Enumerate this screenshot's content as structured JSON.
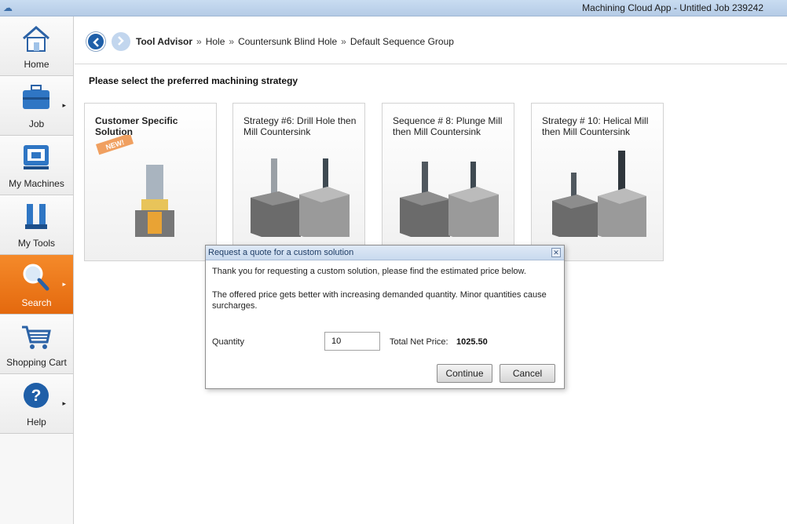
{
  "window": {
    "title": "Machining Cloud App - Untitled Job 239242"
  },
  "sidebar": {
    "items": [
      {
        "label": "Home",
        "icon": "home-icon",
        "has_arrow": false
      },
      {
        "label": "Job",
        "icon": "briefcase-icon",
        "has_arrow": true
      },
      {
        "label": "My Machines",
        "icon": "machine-icon",
        "has_arrow": false
      },
      {
        "label": "My Tools",
        "icon": "tools-icon",
        "has_arrow": false
      },
      {
        "label": "Search",
        "icon": "search-icon",
        "has_arrow": true,
        "active": true
      },
      {
        "label": "Shopping Cart",
        "icon": "cart-icon",
        "has_arrow": false
      },
      {
        "label": "Help",
        "icon": "help-icon",
        "has_arrow": true
      }
    ]
  },
  "breadcrumb": {
    "items": [
      "Tool Advisor",
      "Hole",
      "Countersunk Blind Hole",
      "Default Sequence Group"
    ],
    "separator": "»"
  },
  "main": {
    "instruction": "Please select the preferred machining strategy",
    "cards": [
      {
        "title": "Customer Specific Solution",
        "badge": "NEW!"
      },
      {
        "title": "Strategy #6: Drill Hole then Mill Countersink"
      },
      {
        "title": "Sequence # 8: Plunge Mill then Mill Countersink"
      },
      {
        "title": "Strategy # 10: Helical Mill then Mill Countersink"
      }
    ]
  },
  "dialog": {
    "title": "Request a quote for a custom solution",
    "message1": "Thank you for requesting a custom solution, please find the estimated price below.",
    "message2": "The offered price gets better with increasing demanded quantity. Minor quantities cause surcharges.",
    "quantity_label": "Quantity",
    "quantity_value": "10",
    "price_label": "Total Net Price:",
    "price_value": "1025.50",
    "continue_label": "Continue",
    "cancel_label": "Cancel"
  },
  "colors": {
    "accent": "#e8731a",
    "nav_blue": "#1f5fa8"
  }
}
